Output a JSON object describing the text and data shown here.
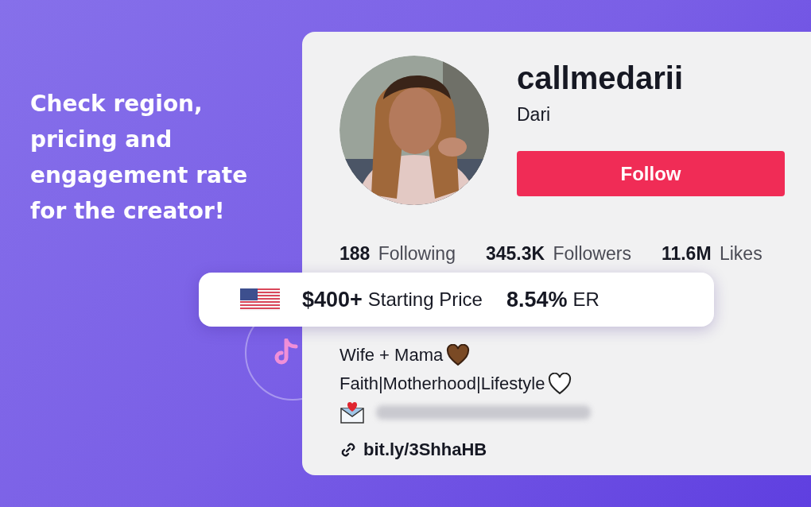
{
  "headline": "Check region, pricing and engagement rate for the creator!",
  "profile": {
    "username": "callmedarii",
    "display_name": "Dari",
    "follow_button": "Follow",
    "stats": [
      "**188** Following",
      "**345.3K** Followers",
      "**11.6M** Likes"
    ],
    "bio_lines": [
      "Wife + Mama",
      "Faith|Motherhood|Lifestyle"
    ],
    "link": "bit.ly/3ShhaHB"
  },
  "insights": {
    "price": "$400+",
    "price_label": "Starting Price",
    "er": "8.54%",
    "er_label": "ER"
  }
}
